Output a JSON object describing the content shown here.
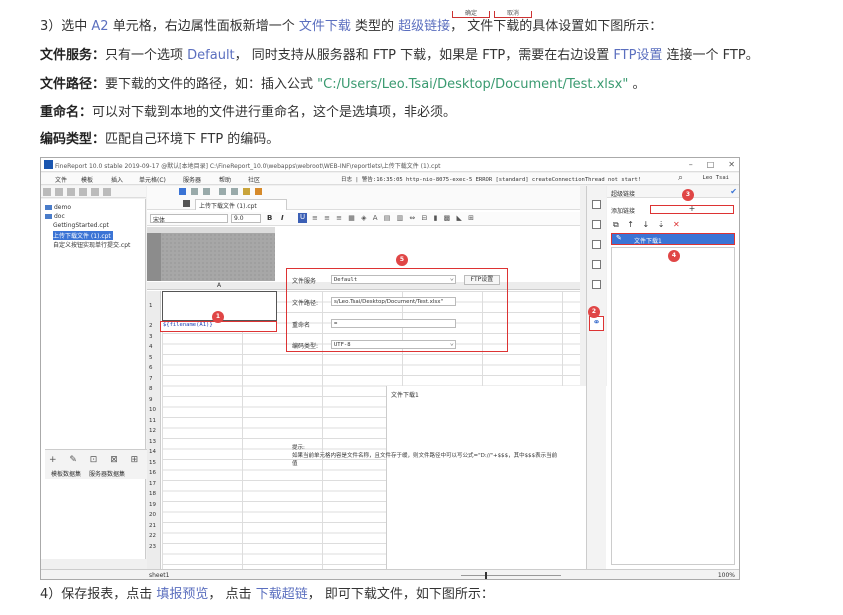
{
  "top_buttons": [
    "确定",
    "取消"
  ],
  "paragraphs": {
    "p1": {
      "a": "3）选中 ",
      "cell": "A2",
      "b": " 单元格，右边属性面板新增一个 ",
      "type": "文件下载",
      "c": " 类型的 ",
      "link": "超级链接",
      "d": "， 文件下载的具体设置如下图所示："
    },
    "p2": {
      "label": "文件服务：",
      "a": "只有一个选项 ",
      "default": "Default",
      "b": "， 同时支持从服务器和 FTP 下载，如果是 FTP，需要在右边设置 ",
      "ftp": "FTP设置",
      "c": " 连接一个 FTP。"
    },
    "p3": {
      "label": "文件路径：",
      "a": "要下载的文件的路径，如：插入公式 ",
      "path": "\"C:/Users/Leo.Tsai/Desktop/Document/Test.xlsx\"",
      "b": " 。"
    },
    "p4": {
      "label": "重命名：",
      "a": "可以对下载到本地的文件进行重命名，这个是选填项，非必须。"
    },
    "p5": {
      "label": "编码类型：",
      "a": "匹配自己环境下 FTP 的编码。"
    },
    "p6": {
      "a": "4）保存报表，点击 ",
      "preview": "填报预览",
      "b": "， 点击 ",
      "dl": "下载超链",
      "c": "， 即可下载文件，如下图所示："
    }
  },
  "screenshot": {
    "title": "FineReport 10.0 stable 2019-09-17 @默认[本地目录]   C:\\FineReport_10.0\\webapps\\webroot\\WEB-INF\\reportlets\\上传下载文件 (1).cpt",
    "menu": [
      "文件",
      "模板",
      "插入",
      "单元格(C)",
      "服务器",
      "帮助",
      "社区"
    ],
    "log": "日志 | 警告:16:35:05 http-nio-8075-exec-5 ERROR [standard] createConnectionThread not start!",
    "user": "Leo Tsai",
    "tree": [
      "demo",
      "doc",
      "GettingStarted.cpt",
      "上传下载文件 (1).cpt",
      "自定义按钮实现单行提交.cpt"
    ],
    "tree_tabs": [
      "模板数据集",
      "服务器数据集"
    ],
    "tab": "上传下载文件 (1).cpt",
    "font": "宋体",
    "font_size": "9.0",
    "col_header": "A",
    "rows": [
      "1",
      "2",
      "3",
      "4",
      "5",
      "6",
      "7",
      "8",
      "9",
      "10",
      "11",
      "12",
      "13",
      "14",
      "15",
      "16",
      "17",
      "18",
      "19",
      "20",
      "21",
      "22",
      "23"
    ],
    "cell_a2": "${filename(A1)}",
    "dialog": {
      "title": "文件下载1",
      "service_label": "文件服务",
      "service_value": "Default",
      "ftp_button": "FTP设置",
      "path_label": "文件路径:",
      "path_value": "s/Leo.Tsai/Desktop/Document/Test.xlsx\"",
      "rename_label": "重命名",
      "rename_value": "=",
      "encoding_label": "编码类型:",
      "encoding_value": "UTF-8",
      "hint": "提示:\n如果当前单元格内容是文件名称，且文件存于缓，则文件路径中可以写公式=\"D://\"+$$$，其中$$$表示当前值"
    },
    "prop": {
      "header": "超级链接",
      "add_label": "添加链接",
      "add_symbol": "+",
      "item": "文件下载1"
    },
    "status": {
      "sheet": "sheet1",
      "zoom": "100%"
    }
  },
  "badges": [
    "1",
    "2",
    "3",
    "4",
    "5"
  ]
}
